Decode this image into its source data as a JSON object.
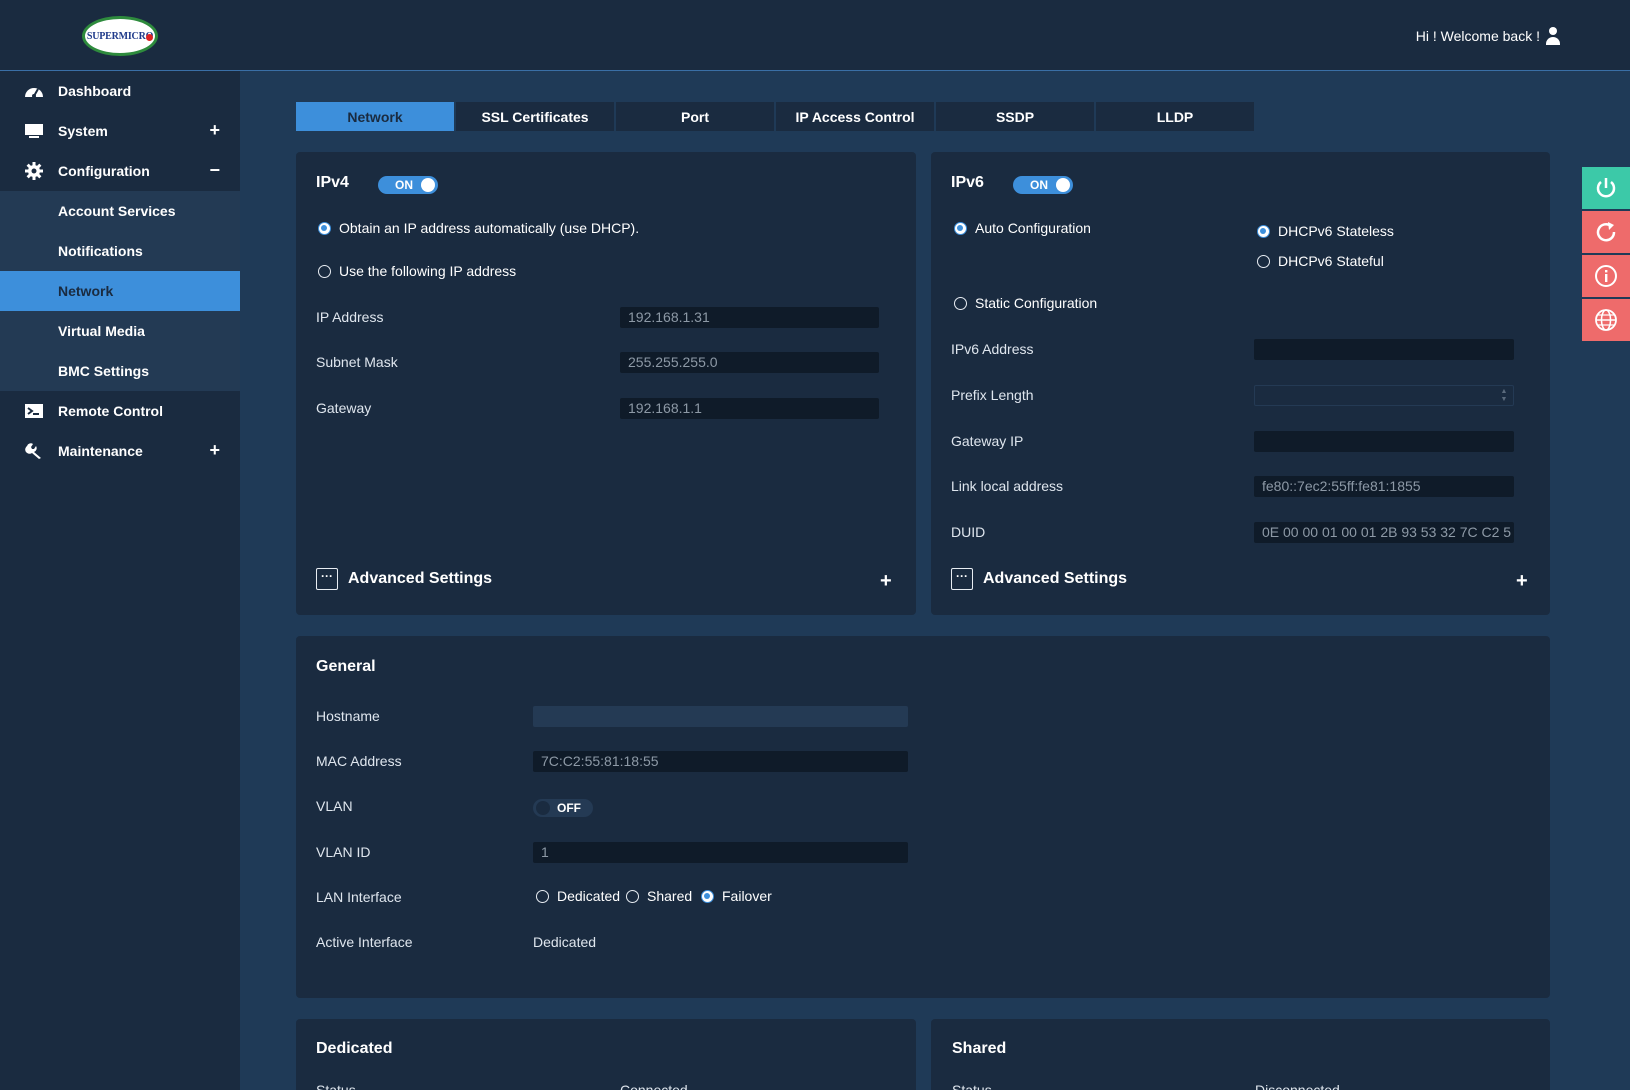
{
  "header": {
    "welcome": "Hi ! Welcome back !",
    "logo_text": "SUPERMICRO"
  },
  "sidebar": {
    "items": [
      {
        "label": "Dashboard",
        "icon": "dashboard-icon"
      },
      {
        "label": "System",
        "icon": "monitor-icon",
        "expander": "+"
      },
      {
        "label": "Configuration",
        "icon": "gear-icon",
        "expander": "−"
      },
      {
        "label": "Remote Control",
        "icon": "terminal-icon"
      },
      {
        "label": "Maintenance",
        "icon": "wrench-icon",
        "expander": "+"
      }
    ],
    "subitems": [
      "Account Services",
      "Notifications",
      "Network",
      "Virtual Media",
      "BMC Settings"
    ],
    "active_subitem": "Network"
  },
  "tabs": [
    "Network",
    "SSL Certificates",
    "Port",
    "IP Access Control",
    "SSDP",
    "LLDP"
  ],
  "active_tab": "Network",
  "ipv4": {
    "title": "IPv4",
    "toggle": "ON",
    "dhcp_option": "Obtain an IP address automatically (use DHCP).",
    "static_option": "Use the following IP address",
    "ip_label": "IP Address",
    "ip_value": "192.168.1.31",
    "mask_label": "Subnet Mask",
    "mask_value": "255.255.255.0",
    "gateway_label": "Gateway",
    "gateway_value": "192.168.1.1",
    "advanced": "Advanced Settings",
    "advanced_box": "···"
  },
  "ipv6": {
    "title": "IPv6",
    "toggle": "ON",
    "auto_option": "Auto Configuration",
    "stateless_option": "DHCPv6 Stateless",
    "stateful_option": "DHCPv6 Stateful",
    "static_option": "Static Configuration",
    "address_label": "IPv6 Address",
    "address_value": "",
    "prefix_label": "Prefix Length",
    "prefix_value": "",
    "gateway_label": "Gateway IP",
    "gateway_value": "",
    "link_local_label": "Link local address",
    "link_local_value": "fe80::7ec2:55ff:fe81:1855",
    "duid_label": "DUID",
    "duid_value": "0E 00 00 01 00 01 2B 93 53 32 7C C2 5",
    "advanced": "Advanced Settings",
    "advanced_box": "···"
  },
  "general": {
    "title": "General",
    "hostname_label": "Hostname",
    "hostname_value": "",
    "mac_label": "MAC Address",
    "mac_value": "7C:C2:55:81:18:55",
    "vlan_label": "VLAN",
    "vlan_toggle": "OFF",
    "vlan_id_label": "VLAN ID",
    "vlan_id_value": "1",
    "lan_label": "LAN Interface",
    "lan_options": [
      "Dedicated",
      "Shared",
      "Failover"
    ],
    "lan_selected": "Failover",
    "active_label": "Active Interface",
    "active_value": "Dedicated"
  },
  "dedicated": {
    "title": "Dedicated",
    "status_label": "Status",
    "status_value": "Connected"
  },
  "shared": {
    "title": "Shared",
    "status_label": "Status",
    "status_value": "Disconnected"
  },
  "quick_actions": [
    {
      "icon": "power-icon",
      "color": "#3cc9a8"
    },
    {
      "icon": "refresh-icon",
      "color": "#ee6b6b"
    },
    {
      "icon": "info-icon",
      "color": "#ee6b6b"
    },
    {
      "icon": "globe-icon",
      "color": "#ee6b6b"
    }
  ],
  "colors": {
    "accent": "#3d8fdb",
    "panel": "#1a2b40",
    "background": "#1f3a57"
  }
}
